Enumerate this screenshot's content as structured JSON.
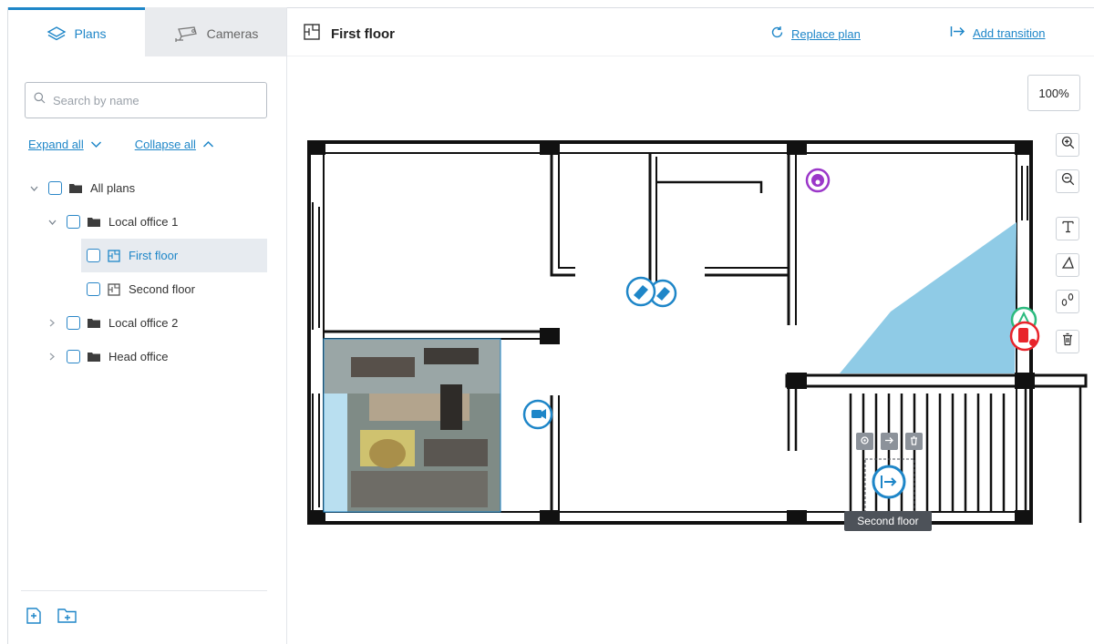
{
  "sidebar": {
    "tabs": [
      {
        "label": "Plans",
        "icon": "layers-icon",
        "active": true
      },
      {
        "label": "Cameras",
        "icon": "camera-icon",
        "active": false
      }
    ],
    "search": {
      "placeholder": "Search by name",
      "value": ""
    },
    "expand_all": "Expand all",
    "collapse_all": "Collapse all",
    "tree": [
      {
        "label": "All plans",
        "type": "folder",
        "expanded": true,
        "level": 0
      },
      {
        "label": "Local office 1",
        "type": "folder",
        "expanded": true,
        "level": 1
      },
      {
        "label": "First floor",
        "type": "plan",
        "selected": true,
        "level": 2
      },
      {
        "label": "Second floor",
        "type": "plan",
        "selected": false,
        "level": 2
      },
      {
        "label": "Local office 2",
        "type": "folder",
        "expanded": false,
        "level": 1
      },
      {
        "label": "Head office",
        "type": "folder",
        "expanded": false,
        "level": 1
      }
    ],
    "bottom_icons": [
      "add-plan-icon",
      "add-folder-icon"
    ]
  },
  "header": {
    "title": "First floor",
    "replace_plan": "Replace plan",
    "add_transition": "Add transition"
  },
  "canvas": {
    "zoom": "100%",
    "tools": [
      "zoom-in-icon",
      "zoom-out-icon",
      "text-tool-icon",
      "shape-tool-icon",
      "transition-tool-icon",
      "delete-icon"
    ],
    "transition_tooltip": "Second floor",
    "colors": {
      "accent": "#1e86c8",
      "camera_blue": "#1e86c8",
      "camera_purple": "#9b37c9",
      "camera_green": "#2dbb7f",
      "alarm_red": "#e8242b",
      "view_cone": "#8fcbe6"
    }
  }
}
